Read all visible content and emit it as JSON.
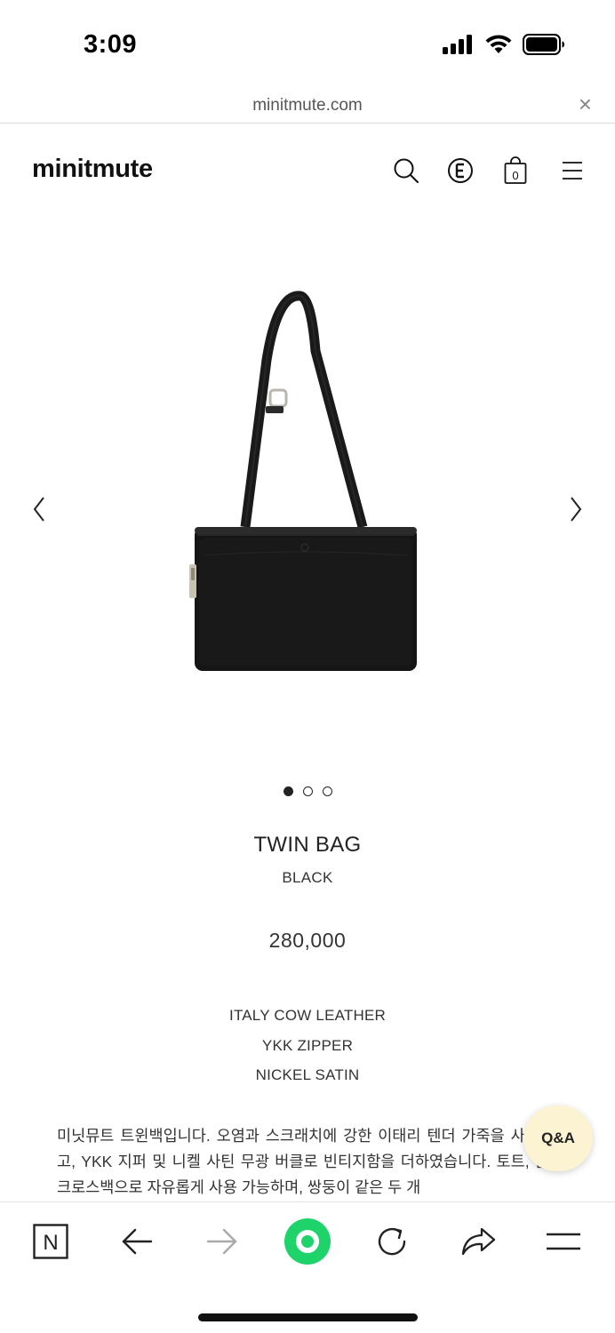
{
  "status_bar": {
    "time": "3:09",
    "icons": [
      "cellular-signal-icon",
      "wifi-icon",
      "battery-icon"
    ]
  },
  "browser": {
    "url": "minitmute.com",
    "close_glyph": "×"
  },
  "header": {
    "logo": "minitmute",
    "icons": [
      "search-icon",
      "currency-e-icon",
      "shopping-bag-icon",
      "menu-icon"
    ],
    "cart_count": "0"
  },
  "gallery": {
    "prev_glyph": "‹",
    "next_glyph": "›",
    "slides": 3,
    "active_slide": 1
  },
  "product": {
    "name": "TWIN BAG",
    "color": "BLACK",
    "price": "280,000",
    "specs": [
      "ITALY COW LEATHER",
      "YKK ZIPPER",
      "NICKEL SATIN"
    ],
    "description": "미닛뮤트 트윈백입니다. 오염과 스크래치에 강한 이태리 텐더 가죽을 사용하였고, YKK 지퍼 및 니켈 사틴 무광 버클로 빈티지함을 더하였습니다. 토트, 숄더, 크로스백으로 자유롭게 사용 가능하며, 쌍둥이 같은 두 개"
  },
  "qa_button": {
    "label": "Q&A"
  },
  "toolbar": {
    "icons": [
      "naver-n-icon",
      "back-arrow-icon",
      "forward-arrow-icon",
      "green-circle-icon",
      "reload-icon",
      "share-icon",
      "menu-icon"
    ],
    "n_label": "N"
  },
  "colors": {
    "accent_green": "#1fd36b",
    "qa_bg": "#fbf3d2",
    "text": "#222222"
  }
}
